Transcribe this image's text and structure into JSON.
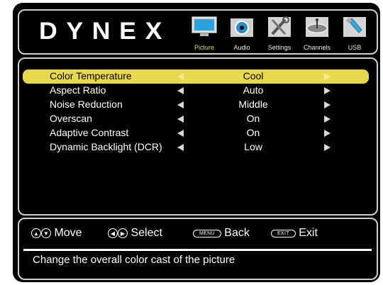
{
  "brand": {
    "logo_text": "DYNEX"
  },
  "tabs": [
    {
      "label": "Picture",
      "icon": "tv-icon",
      "active": true
    },
    {
      "label": "Audio",
      "icon": "speaker-icon",
      "active": false
    },
    {
      "label": "Settings",
      "icon": "tools-icon",
      "active": false
    },
    {
      "label": "Channels",
      "icon": "satellite-dish-icon",
      "active": false
    },
    {
      "label": "USB",
      "icon": "usb-drive-icon",
      "active": false
    }
  ],
  "menu": {
    "items": [
      {
        "label": "Color Temperature",
        "value": "Cool",
        "selected": true
      },
      {
        "label": "Aspect Ratio",
        "value": "Auto",
        "selected": false
      },
      {
        "label": "Noise Reduction",
        "value": "Middle",
        "selected": false
      },
      {
        "label": "Overscan",
        "value": "On",
        "selected": false
      },
      {
        "label": "Adaptive Contrast",
        "value": "On",
        "selected": false
      },
      {
        "label": "Dynamic Backlight (DCR)",
        "value": "Low",
        "selected": false
      }
    ]
  },
  "hints": {
    "move": "Move",
    "select": "Select",
    "menu_key": "MENU",
    "back": "Back",
    "exit_key": "EXIT",
    "exit": "Exit"
  },
  "description": "Change the overall color cast of the picture",
  "colors": {
    "highlight": "#e8d84c",
    "active_tab": "#e7d84a",
    "background": "#000000"
  }
}
